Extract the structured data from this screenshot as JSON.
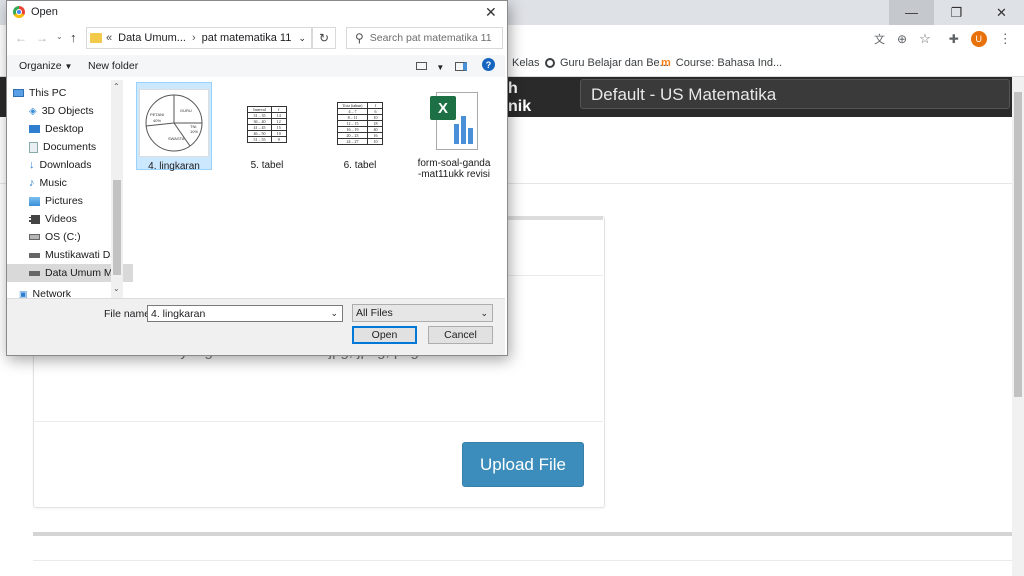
{
  "browser": {
    "bookmarks": [
      {
        "label": "Kelas"
      },
      {
        "label": "Guru Belajar dan Be..."
      },
      {
        "label": "Course: Bahasa Ind..."
      }
    ],
    "profile_initial": "U"
  },
  "page": {
    "header_text": "h\nnik",
    "course_select": "Default - US Matematika",
    "hint": "File yang diizinkan adalah jpg, jpeg, png",
    "upload_button": "Upload File"
  },
  "dialog": {
    "title": "Open",
    "breadcrumb": [
      "Data Umum...",
      "pat matematika 11"
    ],
    "breadcrumb_prefix": "«",
    "search_placeholder": "Search pat matematika 11",
    "organize_label": "Organize",
    "new_folder_label": "New folder",
    "nav_items": [
      {
        "label": "This PC",
        "icon": "computer-icon"
      },
      {
        "label": "3D Objects",
        "icon": "cube-icon"
      },
      {
        "label": "Desktop",
        "icon": "desktop-icon"
      },
      {
        "label": "Documents",
        "icon": "documents-icon"
      },
      {
        "label": "Downloads",
        "icon": "download-icon"
      },
      {
        "label": "Music",
        "icon": "music-icon"
      },
      {
        "label": "Pictures",
        "icon": "pictures-icon"
      },
      {
        "label": "Videos",
        "icon": "videos-icon"
      },
      {
        "label": "OS (C:)",
        "icon": "drive-icon"
      },
      {
        "label": "Mustikawati Dat",
        "icon": "network-drive-icon"
      },
      {
        "label": "Data Umum Mu",
        "icon": "network-drive-icon"
      },
      {
        "label": "Network",
        "icon": "network-icon"
      }
    ],
    "files": [
      {
        "name": "4. lingkaran",
        "kind": "image-pie",
        "selected": true
      },
      {
        "name": "5. tabel",
        "kind": "image-table"
      },
      {
        "name": "6. tabel",
        "kind": "image-table"
      },
      {
        "name": "form-soal-ganda\n-mat11ukk revisi",
        "kind": "excel"
      }
    ],
    "pie_thumb_labels": [
      "PETANI",
      "40%",
      "GURU",
      "TNI",
      "10%",
      "SWASTA"
    ],
    "table5_thumb": {
      "headers": [
        "Interval",
        "f"
      ],
      "rows": [
        [
          "31 – 35",
          "14"
        ],
        [
          "36 – 40",
          "12"
        ],
        [
          "41 – 45",
          "15"
        ],
        [
          "46 – 50",
          "10"
        ],
        [
          "51 – 55",
          "9"
        ]
      ]
    },
    "table6_thumb": {
      "headers": [
        "Usia (tahun)",
        "f"
      ],
      "rows": [
        [
          "4 – 7",
          "6"
        ],
        [
          "8 – 11",
          "10"
        ],
        [
          "12 – 15",
          "18"
        ],
        [
          "16 – 19",
          "40"
        ],
        [
          "20 – 23",
          "16"
        ],
        [
          "24 – 27",
          "10"
        ]
      ]
    },
    "file_name_label": "File name:",
    "file_name_value": "4. lingkaran",
    "file_type_value": "All Files",
    "open_button": "Open",
    "cancel_button": "Cancel"
  }
}
